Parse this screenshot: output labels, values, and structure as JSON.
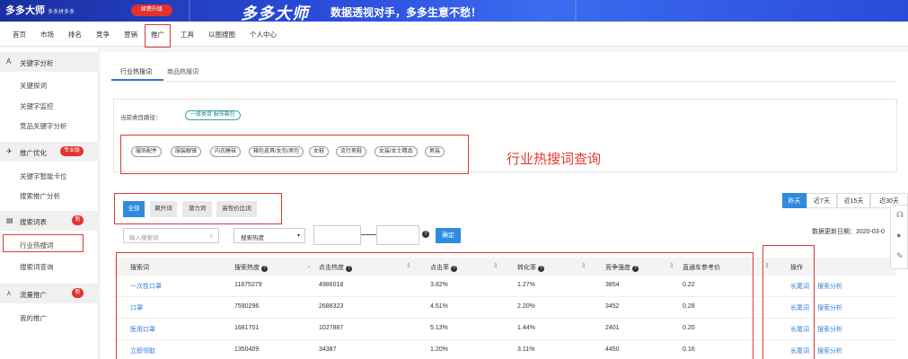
{
  "banner": {
    "logo": "多多大师",
    "logo_sub": "多多拼多多",
    "upgrade": "续费升级",
    "brand": "多多大师",
    "slogan": "数据透视对手，多多生意不愁！"
  },
  "topnav": [
    "首页",
    "市场",
    "排名",
    "竞争",
    "营销",
    "推广",
    "工具",
    "以图搜图",
    "个人中心"
  ],
  "sidebar": {
    "keyword_section": "关键字分析",
    "keyword_items": [
      "关键探词",
      "关键字监控",
      "竞品关键字分析"
    ],
    "promo_section": "推广优化",
    "promo_badge": "专业版",
    "promo_items": [
      "关键字智能卡位",
      "搜索推广分析"
    ],
    "search_section": "搜索词表",
    "search_badge": "新",
    "search_items": [
      "行业热搜词",
      "搜索词查询"
    ],
    "traffic_section": "流量推广",
    "traffic_badge": "新",
    "traffic_items": [
      "我的推广"
    ]
  },
  "tabs": [
    "行业热搜词",
    "商品热搜词"
  ],
  "category": {
    "path_label": "当前类目路径：",
    "path_value": "一级类目 服饰箱包",
    "pills": [
      "服饰配件",
      "服装眼镜",
      "内衣睡袜",
      "箱包皮具/女包/男包",
      "女鞋",
      "流行男鞋",
      "女装/女士精品",
      "男装"
    ]
  },
  "annotation": "行业热搜词查询",
  "segments": [
    "全部",
    "飙升词",
    "潜力词",
    "高性价比词"
  ],
  "days": [
    "昨天",
    "近7天",
    "近15天",
    "近30天"
  ],
  "update_date": "数据更新日期：2020-03-0",
  "filters": {
    "search_placeholder": "输入搜索词",
    "select_value": "搜索热度",
    "ok": "确定"
  },
  "table": {
    "headers": [
      "搜索词",
      "搜索热度",
      "点击热度",
      "点击率",
      "转化率",
      "竞争强度",
      "直通车参考价",
      "操作"
    ],
    "rows": [
      {
        "word": "一次性口罩",
        "search": "11875279",
        "click": "4986018",
        "ctr": "3.82%",
        "cvr": "1.27%",
        "comp": "3854",
        "price": "0.22",
        "op1": "长尾词",
        "op2": "搜索分析"
      },
      {
        "word": "口罩",
        "search": "7590296",
        "click": "2688323",
        "ctr": "4.51%",
        "cvr": "2.20%",
        "comp": "3452",
        "price": "0.28",
        "op1": "长尾词",
        "op2": "搜索分析"
      },
      {
        "word": "医用口罩",
        "search": "1681701",
        "click": "1027887",
        "ctr": "5.13%",
        "cvr": "1.44%",
        "comp": "2401",
        "price": "0.20",
        "op1": "长尾词",
        "op2": "搜索分析"
      },
      {
        "word": "立即领取",
        "search": "1350409",
        "click": "34387",
        "ctr": "1.20%",
        "cvr": "3.11%",
        "comp": "4450",
        "price": "0.16",
        "op1": "长尾词",
        "op2": "搜索分析"
      }
    ]
  },
  "float_tools": [
    "headset-icon",
    "chat-icon",
    "edit-icon"
  ],
  "colors": {
    "primary": "#2f8be0",
    "annotation_red": "#d93a3a",
    "link": "#2f7fd8"
  }
}
